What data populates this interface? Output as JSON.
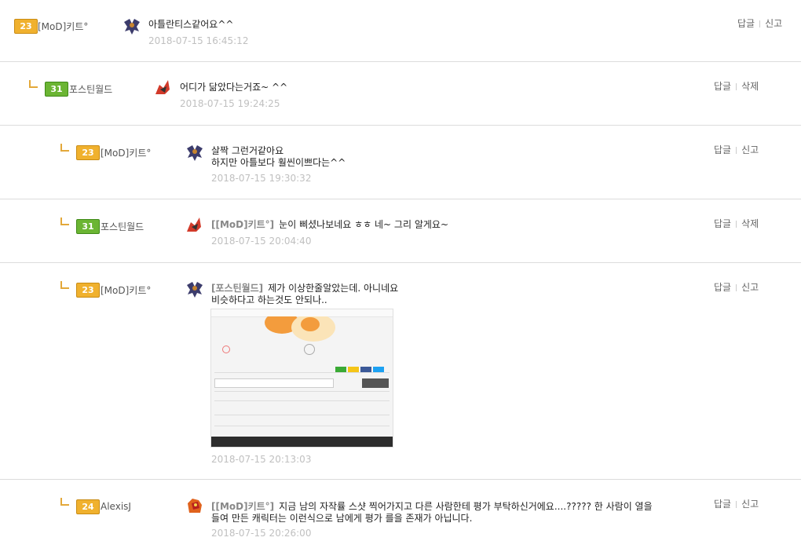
{
  "comments": [
    {
      "level": "23",
      "nick": "[MoD]키트°",
      "mention": "",
      "text": "아틀란티스같어요^^",
      "date": "2018-07-15 16:45:12",
      "reply": "답글",
      "action": "신고"
    },
    {
      "level": "31",
      "nick": "포스틴월드",
      "mention": "",
      "text": "어디가 닮았다는거죠~ ^^",
      "date": "2018-07-15 19:24:25",
      "reply": "답글",
      "action": "삭제"
    },
    {
      "level": "23",
      "nick": "[MoD]키트°",
      "mention": "",
      "line1": "살짝 그런거같아요",
      "line2": "하지만 아틀보다 훨씬이쁘다는^^",
      "date": "2018-07-15 19:30:32",
      "reply": "답글",
      "action": "신고"
    },
    {
      "level": "31",
      "nick": "포스틴월드",
      "mention": "[[MoD]키트°]",
      "text": "눈이 삐셨나보네요 ㅎㅎ 네~ 그리 알게요~",
      "date": "2018-07-15 20:04:40",
      "reply": "답글",
      "action": "삭제"
    },
    {
      "level": "23",
      "nick": "[MoD]키트°",
      "mention": "[포스틴월드]",
      "text": "제가 이상한줄알았는데. 아니네요",
      "line2": "비슷하다고 하는것도 안되나..",
      "date": "2018-07-15 20:13:03",
      "reply": "답글",
      "action": "신고"
    },
    {
      "level": "24",
      "nick": "AlexisJ",
      "mention": "[[MoD]키트°]",
      "text": "지금 남의 자작률 스샷 찍어가지고 다른 사람한테 평가 부탁하신거에요....????? 한 사람이 열을",
      "line2": "들여 만든 캐릭터는 이런식으로 남에게 평가 를을 존재가 아닙니다.",
      "date": "2018-07-15 20:26:00",
      "reply": "답글",
      "action": "신고"
    }
  ],
  "colors": {
    "accent": "#e3a83a",
    "gold_badge": "#f0b12e",
    "green_badge": "#6bb533"
  },
  "icons": {
    "reply_arrow": "reply-arrow-icon",
    "avatar": "avatar-icon",
    "attached": "attached-screenshot"
  }
}
